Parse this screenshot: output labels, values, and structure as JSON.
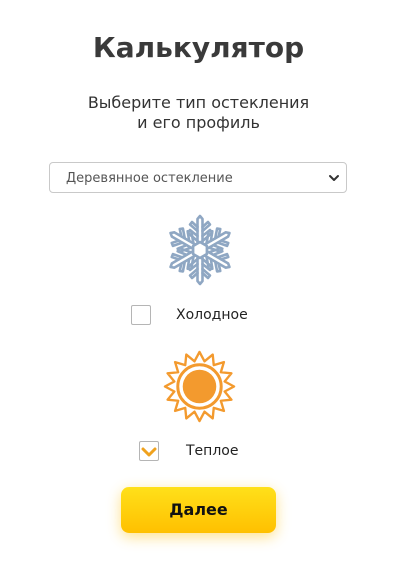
{
  "header": {
    "title": "Калькулятор",
    "subtitle_line1": "Выберите тип остекления",
    "subtitle_line2": "и его профиль"
  },
  "glazing_select": {
    "selected": "Деревянное остекление",
    "icon": "chevron-down-icon"
  },
  "profile_options": [
    {
      "label": "Холодное",
      "icon": "snowflake-icon",
      "icon_color": "#8fa7c3",
      "checked": false
    },
    {
      "label": "Теплое",
      "icon": "sun-icon",
      "icon_color": "#f39a2e",
      "checked": true
    }
  ],
  "actions": {
    "next_label": "Далее"
  },
  "colors": {
    "accent": "#ffc400",
    "check_mark": "#f0a21e",
    "title_text": "#3a3a3a"
  }
}
